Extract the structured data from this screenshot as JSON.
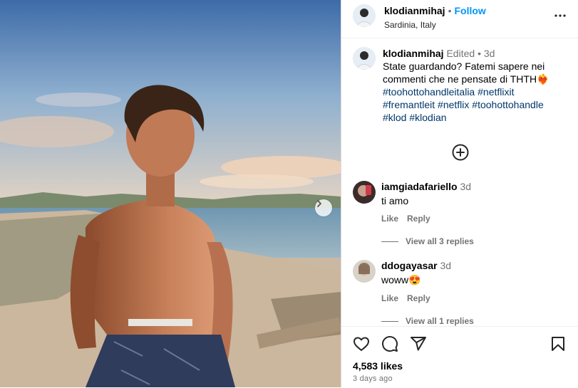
{
  "post": {
    "username": "klodianmihaj",
    "separator": "•",
    "follow_label": "Follow",
    "location": "Sardinia, Italy"
  },
  "caption": {
    "username": "klodianmihaj",
    "edited": "Edited",
    "separator": "•",
    "time": "3d",
    "text": "State guardando? Fatemi sapere nei commenti che ne pensate di THTH❤️‍🔥",
    "hashtags": [
      "#toohottohandleitalia",
      "#netflixit",
      "#fremantleit",
      "#netflix",
      "#toohottohandle",
      "#klod",
      "#klodian"
    ]
  },
  "comments": [
    {
      "username": "iamgiadafariello",
      "time": "3d",
      "text": "ti amo",
      "like": "Like",
      "reply": "Reply",
      "view_replies": "View all 3 replies"
    },
    {
      "username": "ddogayasar",
      "time": "3d",
      "text": "woww😍",
      "like": "Like",
      "reply": "Reply",
      "view_replies": "View all 1 replies"
    }
  ],
  "footer": {
    "likes": "4,583 likes",
    "date": "3 days ago"
  },
  "icons": {
    "more": "more-options-icon",
    "add_comment": "add-circle-icon",
    "like": "heart-icon",
    "comment": "comment-icon",
    "share": "share-icon",
    "save": "bookmark-icon",
    "next": "chevron-right-icon"
  }
}
